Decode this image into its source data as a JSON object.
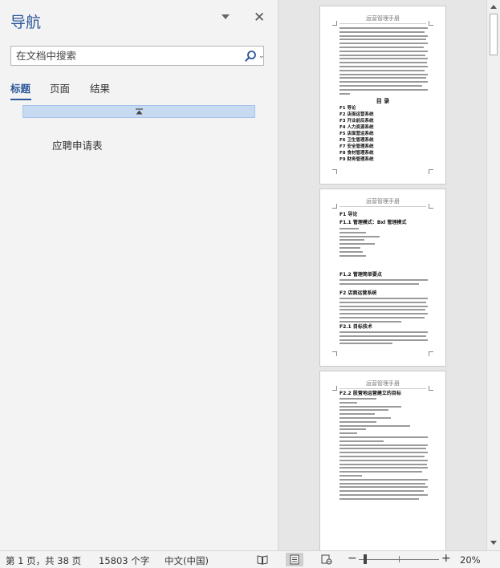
{
  "nav": {
    "title": "导航",
    "search_placeholder": "在文档中搜索",
    "tabs": [
      "标题",
      "页面",
      "结果"
    ],
    "headings": [
      "应聘申请表"
    ]
  },
  "pages": [
    {
      "header": "运营管理手册",
      "toc_title": "目 录",
      "toc": [
        "F1 导论",
        "F2 店面运营系统",
        "F3 开业前后系统",
        "F4 人力资源系统",
        "F5 店面营运系统",
        "F6 卫生管理系统",
        "F7 安全管理系统",
        "F8 食材管理系统",
        "F9 财务管理系统"
      ]
    },
    {
      "header": "运营管理手册",
      "labels": [
        "F1 导论",
        "F1.1 管理模式：Bxl 管理模式",
        "F1.2 管理简单要点",
        "F2 店面运营系统",
        "F2.1 目标技术"
      ]
    },
    {
      "header": "运营管理手册",
      "labels": [
        "F2.2 股营地运营建立的目标"
      ]
    }
  ],
  "status": {
    "page_info": "第 1 页，共 38 页",
    "word_count": "15803 个字",
    "language": "中文(中国)",
    "zoom": "20%",
    "zoom_fraction": 0.08
  }
}
